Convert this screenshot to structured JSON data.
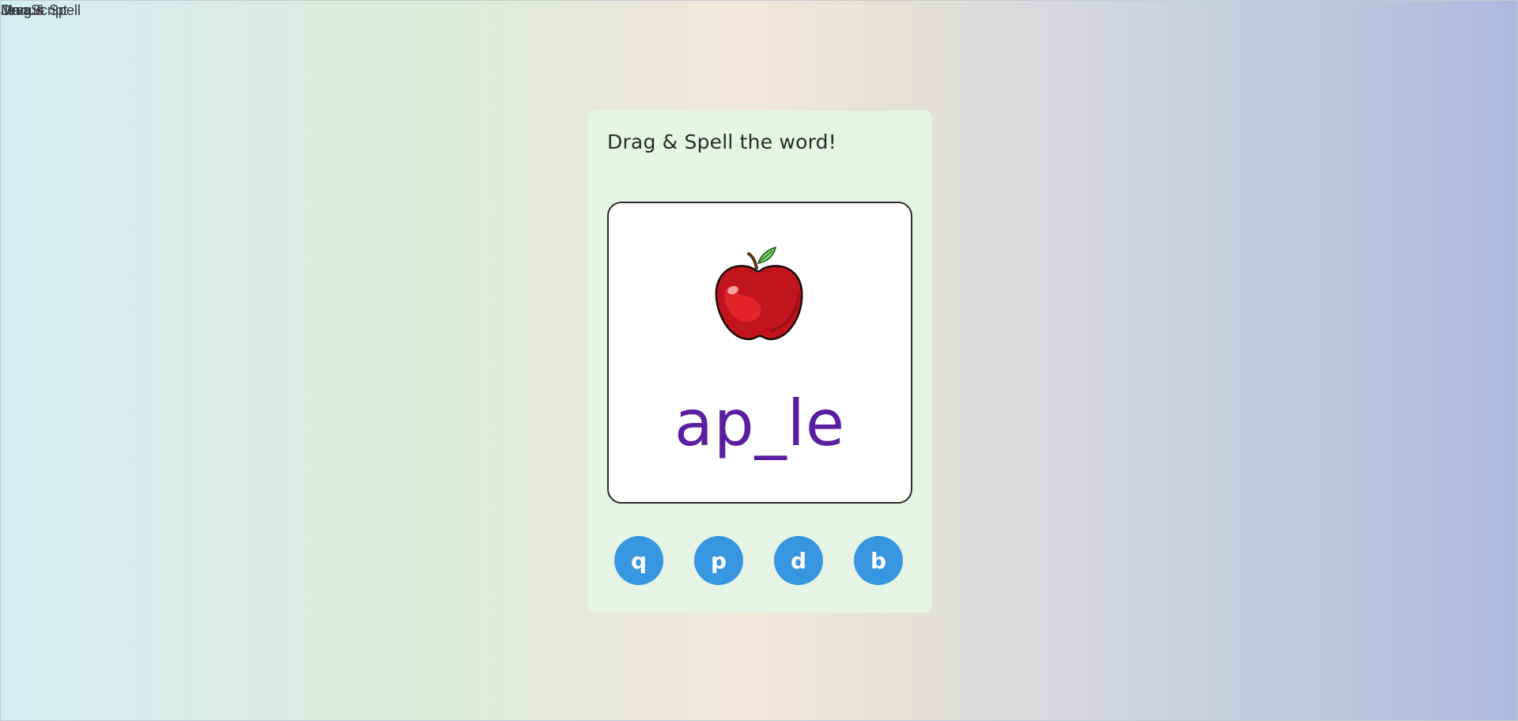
{
  "overlapping_header_text": [
    "Manus",
    "Drag & Spell",
    "JavaScript"
  ],
  "card": {
    "instruction": "Drag & Spell the word!",
    "image": "apple",
    "word": "ap_le",
    "choices": [
      "q",
      "p",
      "d",
      "b"
    ]
  },
  "colors": {
    "card_bg": "#e6f4e6",
    "word_color": "#5a1fa0",
    "choice_bg": "#3696e0"
  }
}
